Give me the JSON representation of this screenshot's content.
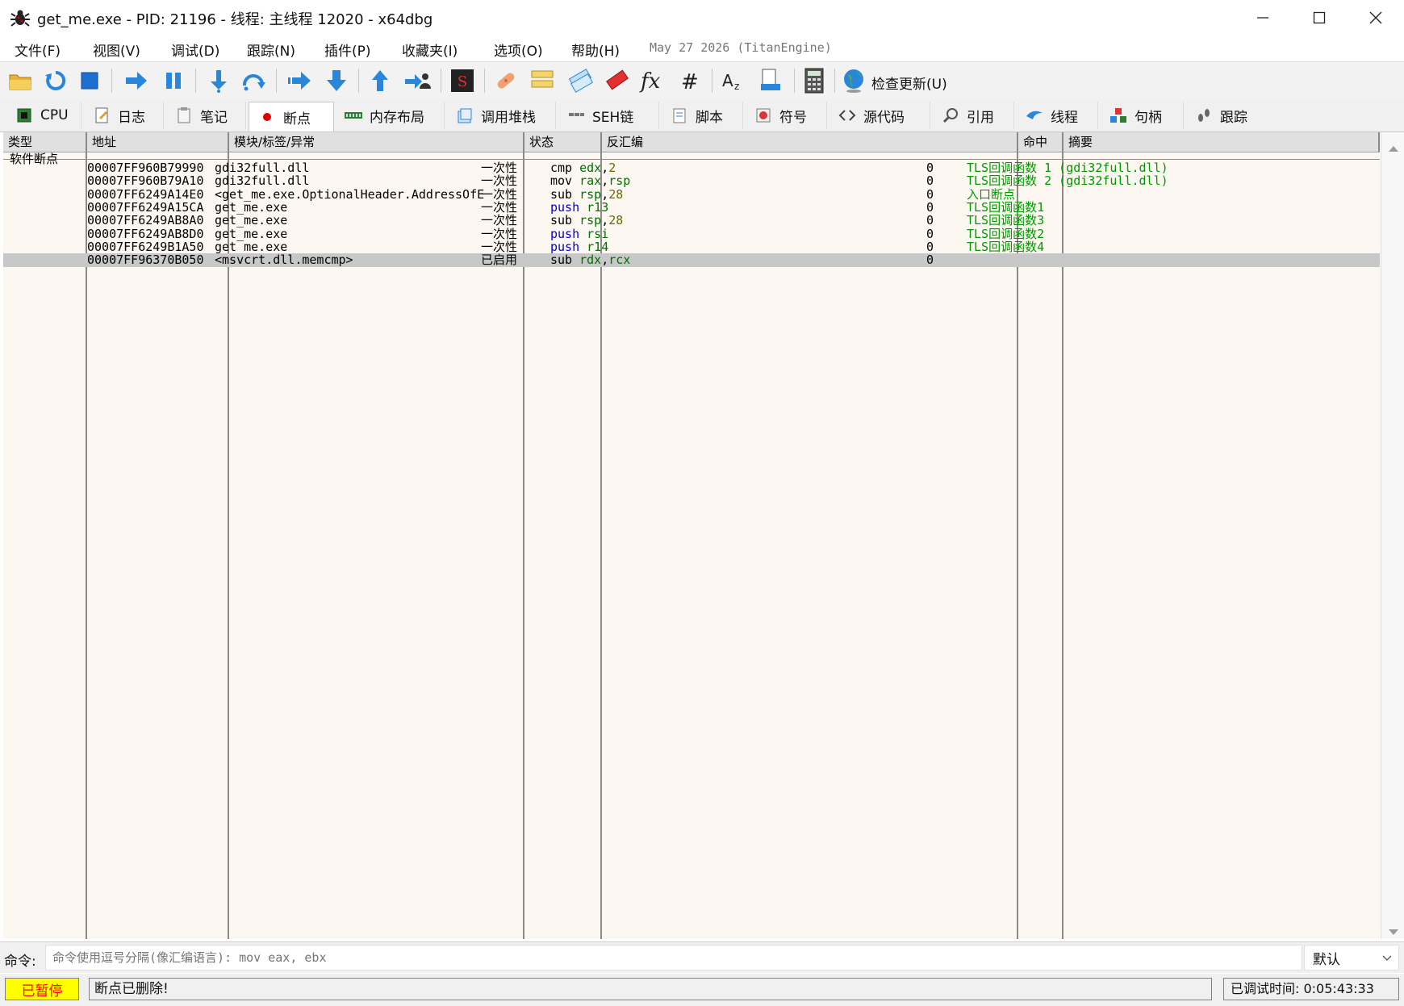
{
  "window": {
    "title": "get_me.exe - PID: 21196 - 线程: 主线程 12020 - x64dbg",
    "minimize": "—",
    "maximize": "☐",
    "close": "✕"
  },
  "menu": {
    "items": [
      "文件(F)",
      "视图(V)",
      "调试(D)",
      "跟踪(N)",
      "插件(P)",
      "收藏夹(I)",
      "选项(O)",
      "帮助(H)"
    ],
    "date_info": "May 27 2026 (TitanEngine)"
  },
  "toolbar": {
    "icons": [
      "open-icon",
      "restart-icon",
      "stop-icon",
      "run-icon",
      "pause-icon",
      "step-into-icon",
      "step-over-icon",
      "trace-into-icon",
      "trace-over-icon",
      "execute-till-return-icon",
      "run-to-user-code-icon",
      "scylla-icon",
      "patch-icon",
      "comments-icon",
      "labels-icon",
      "bookmarks-icon",
      "functions-icon",
      "variables-icon",
      "strings-icon",
      "pe-icon",
      "calculator-icon",
      "check-update-icon"
    ],
    "check_update_label": "检查更新(U)"
  },
  "tabs": [
    {
      "label": "CPU",
      "icon": "cpu-icon"
    },
    {
      "label": "日志",
      "icon": "log-icon"
    },
    {
      "label": "笔记",
      "icon": "notes-icon"
    },
    {
      "label": "断点",
      "icon": "breakpoint-icon",
      "active": true
    },
    {
      "label": "内存布局",
      "icon": "memory-map-icon"
    },
    {
      "label": "调用堆栈",
      "icon": "call-stack-icon"
    },
    {
      "label": "SEH链",
      "icon": "seh-icon"
    },
    {
      "label": "脚本",
      "icon": "script-icon"
    },
    {
      "label": "符号",
      "icon": "symbols-icon"
    },
    {
      "label": "源代码",
      "icon": "source-icon"
    },
    {
      "label": "引用",
      "icon": "references-icon"
    },
    {
      "label": "线程",
      "icon": "threads-icon"
    },
    {
      "label": "句柄",
      "icon": "handles-icon"
    },
    {
      "label": "跟踪",
      "icon": "trace-icon"
    }
  ],
  "table": {
    "headers": [
      "类型",
      "地址",
      "模块/标签/异常",
      "状态",
      "反汇编",
      "命中",
      "摘要"
    ],
    "group_label": "软件断点",
    "rows": [
      {
        "address": "00007FF960B79990",
        "module": "gdi32full.dll",
        "state": "一次性",
        "asm_op": "cmp",
        "asm_args": [
          [
            "edx",
            "reg"
          ],
          [
            ",",
            "kw"
          ],
          [
            "2",
            "num"
          ]
        ],
        "hits": "0",
        "summary": "TLS回调函数 1 (gdi32full.dll)"
      },
      {
        "address": "00007FF960B79A10",
        "module": "gdi32full.dll",
        "state": "一次性",
        "asm_op": "mov",
        "asm_args": [
          [
            "rax",
            "reg"
          ],
          [
            ",",
            "kw"
          ],
          [
            "rsp",
            "reg"
          ]
        ],
        "hits": "0",
        "summary": "TLS回调函数 2 (gdi32full.dll)"
      },
      {
        "address": "00007FF6249A14E0",
        "module": "<get_me.exe.OptionalHeader.AddressOfE",
        "state": "一次性",
        "asm_op": "sub",
        "asm_args": [
          [
            "rsp",
            "reg"
          ],
          [
            ",",
            "kw"
          ],
          [
            "28",
            "num"
          ]
        ],
        "hits": "0",
        "summary": "入口断点"
      },
      {
        "address": "00007FF6249A15CA",
        "module": "get_me.exe",
        "state": "一次性",
        "asm_op": "push",
        "asm_args": [
          [
            "r13",
            "reg"
          ]
        ],
        "hits": "0",
        "summary": "TLS回调函数1"
      },
      {
        "address": "00007FF6249AB8A0",
        "module": "get_me.exe",
        "state": "一次性",
        "asm_op": "sub",
        "asm_args": [
          [
            "rsp",
            "reg"
          ],
          [
            ",",
            "kw"
          ],
          [
            "28",
            "num"
          ]
        ],
        "hits": "0",
        "summary": "TLS回调函数3"
      },
      {
        "address": "00007FF6249AB8D0",
        "module": "get_me.exe",
        "state": "一次性",
        "asm_op": "push",
        "asm_args": [
          [
            "rsi",
            "reg"
          ]
        ],
        "hits": "0",
        "summary": "TLS回调函数2"
      },
      {
        "address": "00007FF6249B1A50",
        "module": "get_me.exe",
        "state": "一次性",
        "asm_op": "push",
        "asm_args": [
          [
            "r14",
            "reg"
          ]
        ],
        "hits": "0",
        "summary": "TLS回调函数4"
      },
      {
        "address": "00007FF96370B050",
        "module": "<msvcrt.dll.memcmp>",
        "state": "已启用",
        "asm_op": "sub",
        "asm_args": [
          [
            "rdx",
            "reg"
          ],
          [
            ",",
            "kw"
          ],
          [
            "rcx",
            "reg"
          ]
        ],
        "hits": "0",
        "summary": "",
        "selected": true
      }
    ]
  },
  "command": {
    "label": "命令:",
    "placeholder": "命令使用逗号分隔(像汇编语言): mov eax, ebx",
    "mode": "默认"
  },
  "status": {
    "state": "已暂停",
    "message": "断点已删除!",
    "debug_time": "已调试时间:  0:05:43:33"
  }
}
